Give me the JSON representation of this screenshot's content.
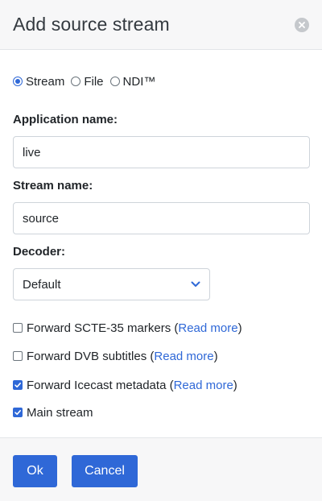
{
  "dialog": {
    "title": "Add source stream"
  },
  "source_type": {
    "options": [
      {
        "label": "Stream",
        "checked": true
      },
      {
        "label": "File",
        "checked": false
      },
      {
        "label": "NDI™",
        "checked": false
      }
    ]
  },
  "application": {
    "label": "Application name:",
    "value": "live"
  },
  "stream": {
    "label": "Stream name:",
    "value": "source"
  },
  "decoder": {
    "label": "Decoder:",
    "selected": "Default"
  },
  "checkboxes": [
    {
      "text": "Forward SCTE-35 markers (",
      "link": "Read more",
      "suffix": ")",
      "checked": false
    },
    {
      "text": "Forward DVB subtitles (",
      "link": "Read more",
      "suffix": ")",
      "checked": false
    },
    {
      "text": "Forward Icecast metadata (",
      "link": "Read more",
      "suffix": ")",
      "checked": true
    },
    {
      "text": "Main stream",
      "link": "",
      "suffix": "",
      "checked": true
    }
  ],
  "footer": {
    "ok_label": "Ok",
    "cancel_label": "Cancel"
  },
  "colors": {
    "accent": "#2f68d7",
    "header_bg": "#f7f7f8",
    "border": "#ced4da"
  },
  "icons": {
    "close": "close-icon",
    "select_chevron": "chevron-down-icon"
  }
}
